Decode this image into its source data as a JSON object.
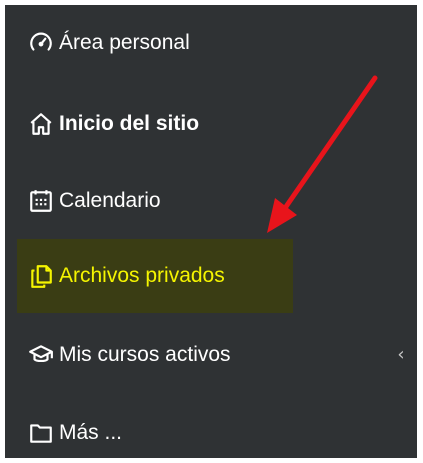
{
  "nav": {
    "items": [
      {
        "label": "Área personal",
        "icon": "dashboard-icon"
      },
      {
        "label": "Inicio del sitio",
        "icon": "home-icon"
      },
      {
        "label": "Calendario",
        "icon": "calendar-icon"
      },
      {
        "label": "Archivos privados",
        "icon": "files-icon",
        "highlighted": true
      },
      {
        "label": "Mis cursos activos",
        "icon": "graduation-cap-icon",
        "expandable": true
      },
      {
        "label": "Más ...",
        "icon": "folder-icon"
      }
    ]
  },
  "colors": {
    "panel_background": "#2f3234",
    "text": "#ffffff",
    "highlight_text": "#f5f500",
    "highlight_background": "#3a3d14",
    "annotation_arrow": "#e8141b"
  }
}
